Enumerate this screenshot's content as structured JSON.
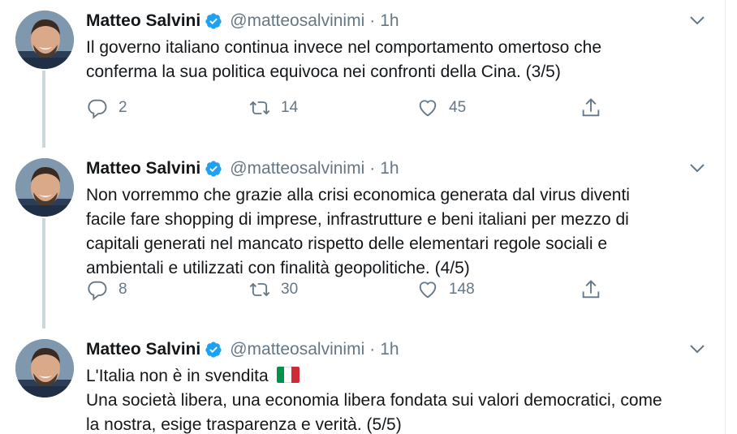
{
  "tweets": [
    {
      "name": "Matteo Salvini",
      "handle": "@matteosalvinimi",
      "separator": "·",
      "time": "1h",
      "lines": [
        "Il governo italiano continua invece nel comportamento omertoso che",
        "conferma la sua politica equivoca nei confronti della Cina. (3/5)"
      ],
      "replies": "2",
      "retweets": "14",
      "likes": "45"
    },
    {
      "name": "Matteo Salvini",
      "handle": "@matteosalvinimi",
      "separator": "·",
      "time": "1h",
      "lines": [
        "Non vorremmo che grazie alla crisi economica generata dal virus diventi",
        "facile fare shopping di imprese, infrastrutture e beni italiani per mezzo di",
        "capitali generati nel mancato rispetto delle elementari regole sociali e",
        "ambientali e utilizzati con finalità geopolitiche. (4/5)"
      ],
      "replies": "8",
      "retweets": "30",
      "likes": "148"
    },
    {
      "name": "Matteo Salvini",
      "handle": "@matteosalvinimi",
      "separator": "·",
      "time": "1h",
      "lines": [
        "L'Italia non è in svendita",
        "Una società libera, una economia libera fondata sui valori democratici, come",
        "la nostra, esige trasparenza e verità. (5/5)"
      ],
      "flag": "italy-flag-emoji"
    }
  ],
  "colors": {
    "text": "#14171a",
    "secondary": "#657786",
    "verified": "#1da1f2",
    "thread_line": "#ccd6dd",
    "flag": [
      "#009246",
      "#ffffff",
      "#ce2b37"
    ]
  },
  "icons": [
    "verified-badge-icon",
    "caret-down-icon",
    "reply-icon",
    "retweet-icon",
    "like-icon",
    "share-icon"
  ]
}
